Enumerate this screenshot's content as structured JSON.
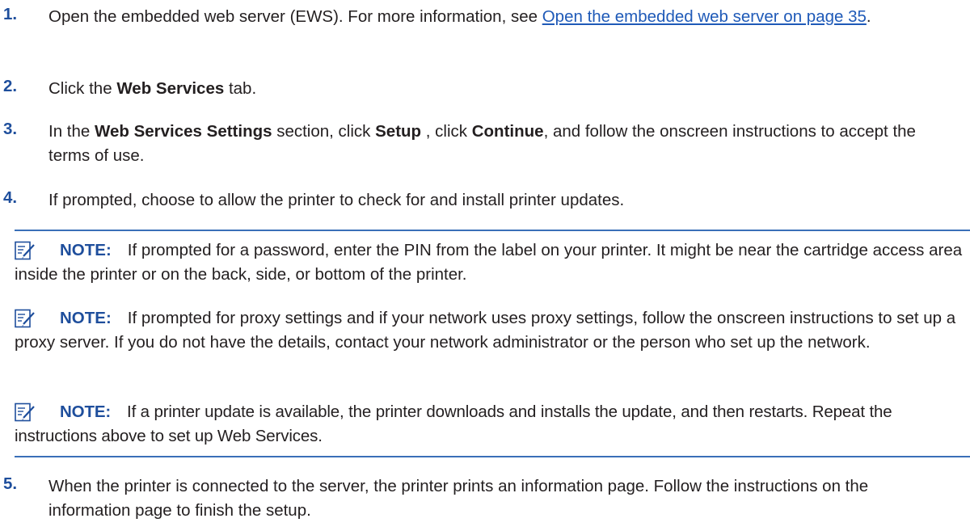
{
  "steps": [
    {
      "num": "1.",
      "text_a": "Open the embedded web server (EWS). For more information, see ",
      "link": "Open the embedded web server on page 35",
      "text_b": "."
    },
    {
      "num": "2.",
      "pre": "Click the ",
      "bold": "Web Services",
      "post": " tab."
    },
    {
      "num": "3.",
      "pre": "In the ",
      "bold1": "Web Services Settings",
      "mid1": " section, click ",
      "bold2": "Setup",
      "mid2": " , click ",
      "bold3": "Continue",
      "post": ", and follow the onscreen instructions to accept the terms of use."
    },
    {
      "num": "4.",
      "text": "If prompted, choose to allow the printer to check for and install printer updates."
    },
    {
      "num": "5.",
      "text": "When the printer is connected to the server, the printer prints an information page. Follow the instructions on the information page to finish the setup."
    }
  ],
  "notes": [
    {
      "label": "NOTE:",
      "text": "If prompted for a password, enter the PIN from the label on your printer. It might be near the cartridge access area inside the printer or on the back, side, or bottom of the printer."
    },
    {
      "label": "NOTE:",
      "text": "If prompted for proxy settings and if your network uses proxy settings, follow the onscreen instructions to set up a proxy server. If you do not have the details, contact your network administrator or the person who set up the network."
    },
    {
      "label": "NOTE:",
      "text": "If a printer update is available, the printer downloads and installs the update, and then restarts. Repeat the instructions above to set up Web Services."
    }
  ],
  "colors": {
    "accent": "#1e4e9c",
    "link": "#1f5ab8",
    "rule": "#3a6fb8",
    "text": "#231f20"
  },
  "icons": {
    "note": "note-pencil-icon"
  }
}
